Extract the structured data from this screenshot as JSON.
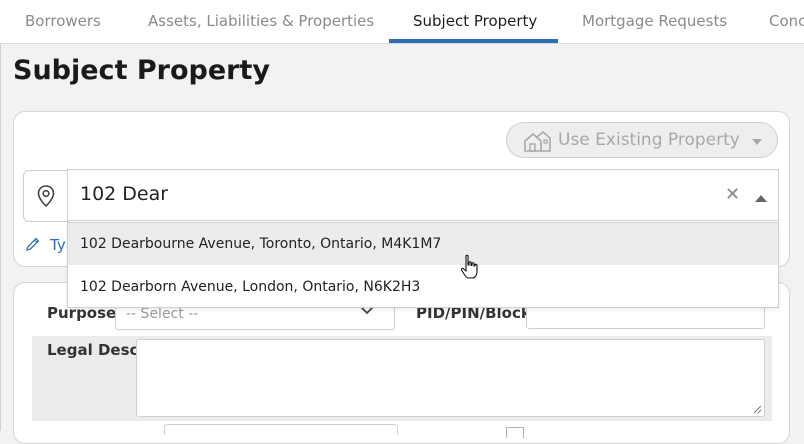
{
  "tabs": [
    {
      "label": "Borrowers",
      "active": false
    },
    {
      "label": "Assets, Liabilities & Properties",
      "active": false
    },
    {
      "label": "Subject Property",
      "active": true
    },
    {
      "label": "Mortgage Requests",
      "active": false
    },
    {
      "label": "Conc",
      "active": false
    }
  ],
  "page": {
    "title": "Subject Property"
  },
  "use_existing": {
    "label": "Use Existing Property",
    "icon": "house-icon"
  },
  "address_search": {
    "value": "102 Dear",
    "options": [
      {
        "label": "102 Dearbourne Avenue, Toronto, Ontario, M4K1M7",
        "highlighted": true
      },
      {
        "label": "102 Dearborn Avenue, London, Ontario, N6K2H3",
        "highlighted": false
      }
    ],
    "hint": "Ty"
  },
  "form": {
    "purpose_label": "Purpose",
    "purpose_value": "-- Select --",
    "pid_label": "PID/PIN/Block",
    "pid_value": "",
    "legal_label": "Legal Desc.",
    "legal_value": ""
  },
  "colors": {
    "accent": "#2c6cb0",
    "highlight": "#ececec",
    "disabled": "#a8a8a8"
  }
}
